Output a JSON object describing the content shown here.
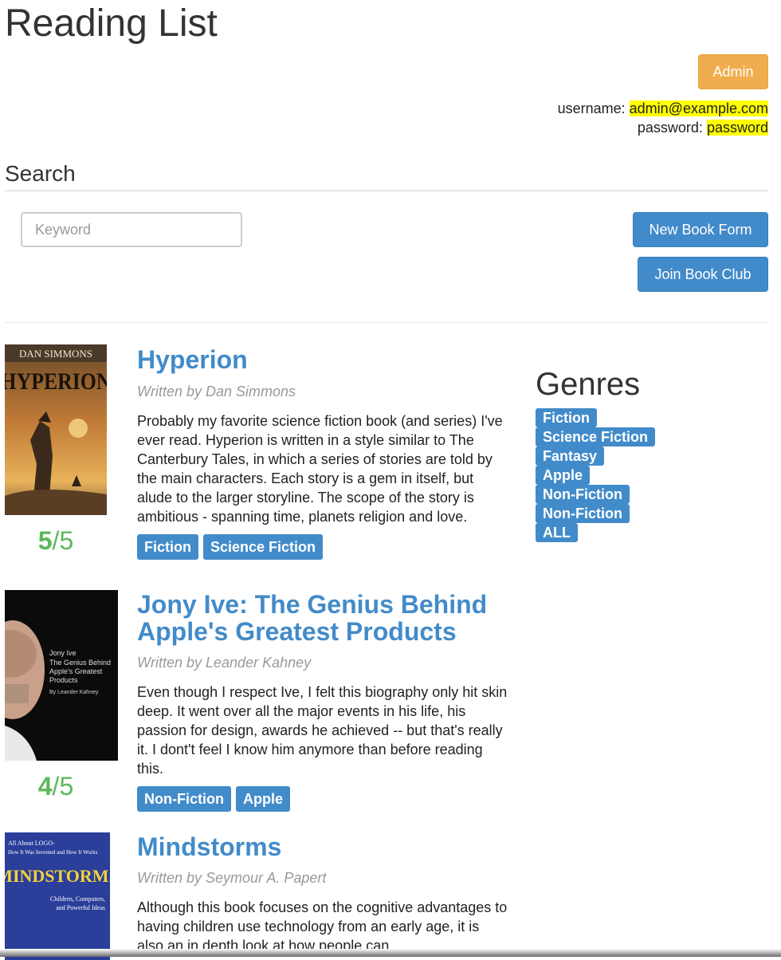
{
  "page": {
    "title": "Reading List"
  },
  "header": {
    "admin_button": "Admin",
    "username_label": "username:",
    "username_value": "admin@example.com",
    "password_label": "password:",
    "password_value": "password"
  },
  "search": {
    "heading": "Search",
    "keyword_placeholder": "Keyword",
    "new_book_button": "New Book Form",
    "join_club_button": "Join Book Club"
  },
  "books": [
    {
      "title": "Hyperion",
      "author": "Written by Dan Simmons",
      "review": "Probably my favorite science fiction book (and series) I've ever read. Hyperion is written in a style similar to The Canterbury Tales, in which a series of stories are told by the main characters. Each story is a gem in itself, but alude to the larger storyline. The scope of the story is ambitious - spanning time, planets religion and love.",
      "rating": "5",
      "rating_max": "/5",
      "tags": [
        "Fiction",
        "Science Fiction"
      ],
      "cover_text": [
        "DAN SIMMONS",
        "HYPERION"
      ]
    },
    {
      "title": "Jony Ive: The Genius Behind Apple's Greatest Products",
      "author": "Written by Leander Kahney",
      "review": "Even though I respect Ive, I felt this biography only hit skin deep. It went over all the major events in his life, his passion for design, awards he achieved -- but that's really it. I dont't feel I know him anymore than before reading this.",
      "rating": "4",
      "rating_max": "/5",
      "tags": [
        "Non-Fiction",
        "Apple"
      ],
      "cover_text": [
        "Jony Ive",
        "The Genius Behind",
        "Apple's Greatest",
        "Products",
        "By Leander Kahney"
      ]
    },
    {
      "title": "Mindstorms",
      "author": "Written by Seymour A. Papert",
      "review": "Although this book focuses on the cognitive advantages to having children use technology from an early age, it is also an in depth look at how people can",
      "cover_text": [
        "All About LOGO-",
        "How It Was Invented and How It Works",
        "MINDSTORMS",
        "Children, Computers,",
        "and Powerful Ideas"
      ]
    }
  ],
  "genres": {
    "title": "Genres",
    "items": [
      "Fiction",
      "Science Fiction",
      "Fantasy",
      "Apple",
      "Non-Fiction",
      "Non-Fiction",
      "ALL"
    ]
  },
  "colors": {
    "primary": "#428bca",
    "warning": "#f0ad4e",
    "rating": "#5cb85c",
    "highlight": "#ffff00"
  }
}
